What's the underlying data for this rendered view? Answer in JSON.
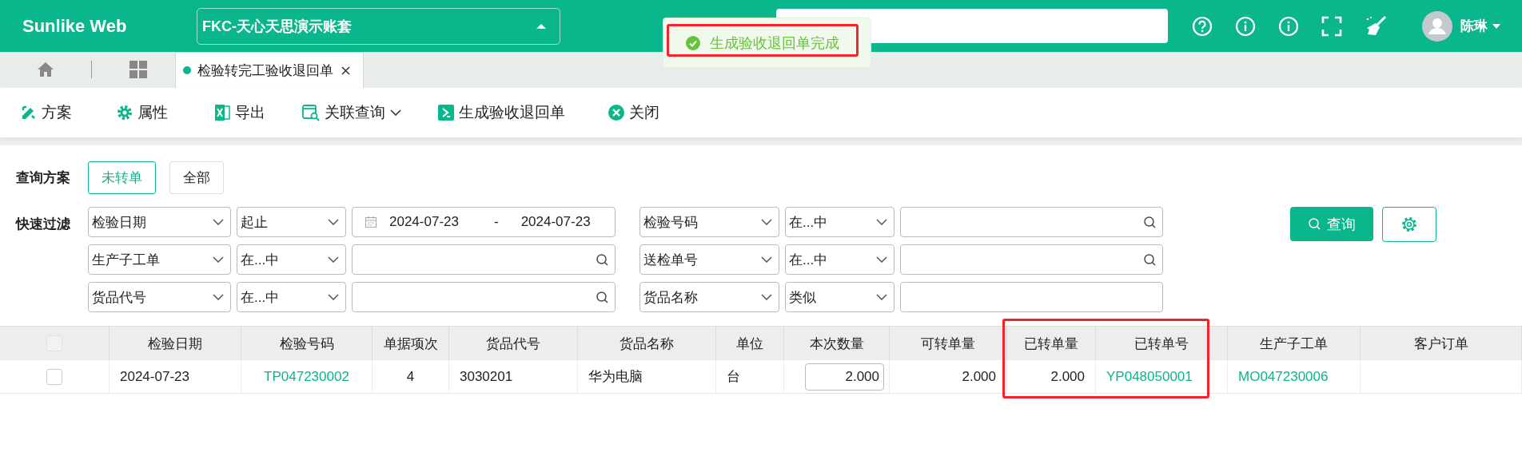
{
  "header": {
    "brand": "Sunlike Web",
    "account": "FKC-天心天思演示账套",
    "user": "陈琳"
  },
  "toast": {
    "message": "生成验收退回单完成",
    "highlighted": true
  },
  "tabs": [
    {
      "label": "检验转完工验收退回单",
      "selected": true
    }
  ],
  "toolbar": [
    {
      "label": "方案",
      "kind": "scheme"
    },
    {
      "label": "属性",
      "kind": "settings"
    },
    {
      "label": "导出",
      "kind": "excel"
    },
    {
      "label": "关联查询",
      "kind": "report",
      "dropdown": true
    },
    {
      "label": "生成验收退回单",
      "kind": "generate"
    },
    {
      "label": "关闭",
      "kind": "close"
    }
  ],
  "query": {
    "label": "查询方案",
    "schemes": [
      {
        "label": "未转单",
        "selected": true
      },
      {
        "label": "全部",
        "selected": false
      }
    ]
  },
  "filter": {
    "label": "快速过滤",
    "search_button": "查询",
    "rows": [
      [
        {
          "field": "检验日期",
          "operator": "起止",
          "kind": "date_range",
          "from": "2024-07-23",
          "separator": "-",
          "to": "2024-07-23"
        },
        {
          "field": "检验号码",
          "operator": "在...中",
          "kind": "search"
        }
      ],
      [
        {
          "field": "生产子工单",
          "operator": "在...中",
          "kind": "search"
        },
        {
          "field": "送检单号",
          "operator": "在...中",
          "kind": "search"
        }
      ],
      [
        {
          "field": "货品代号",
          "operator": "在...中",
          "kind": "search"
        },
        {
          "field": "货品名称",
          "operator": "类似",
          "kind": "text"
        }
      ]
    ]
  },
  "table": {
    "select_all": {
      "checked": false
    },
    "columns": [
      {
        "label": "检验日期",
        "highlighted": false
      },
      {
        "label": "检验号码",
        "highlighted": false
      },
      {
        "label": "单据项次",
        "highlighted": false
      },
      {
        "label": "货品代号",
        "highlighted": false
      },
      {
        "label": "货品名称",
        "highlighted": false
      },
      {
        "label": "单位",
        "highlighted": false
      },
      {
        "label": "本次数量",
        "highlighted": false
      },
      {
        "label": "可转单量",
        "highlighted": false
      },
      {
        "label": "已转单量",
        "highlighted": true
      },
      {
        "label": "已转单号",
        "highlighted": true
      },
      {
        "label": "生产子工单",
        "highlighted": false
      },
      {
        "label": "客户订单",
        "highlighted": false
      }
    ],
    "rows": [
      {
        "selected": false,
        "cells": [
          {
            "kind": "text",
            "value": "2024-07-23"
          },
          {
            "kind": "link",
            "value": "TP047230002"
          },
          {
            "kind": "text",
            "value": "4"
          },
          {
            "kind": "text",
            "value": "3030201"
          },
          {
            "kind": "text",
            "value": "华为电脑"
          },
          {
            "kind": "text",
            "value": "台"
          },
          {
            "kind": "input",
            "value": "2.000"
          },
          {
            "kind": "text",
            "value": "2.000"
          },
          {
            "kind": "text",
            "value": "2.000"
          },
          {
            "kind": "link",
            "value": "YP048050001"
          },
          {
            "kind": "link",
            "value": "MO047230006"
          },
          {
            "kind": "empty"
          }
        ]
      }
    ]
  }
}
